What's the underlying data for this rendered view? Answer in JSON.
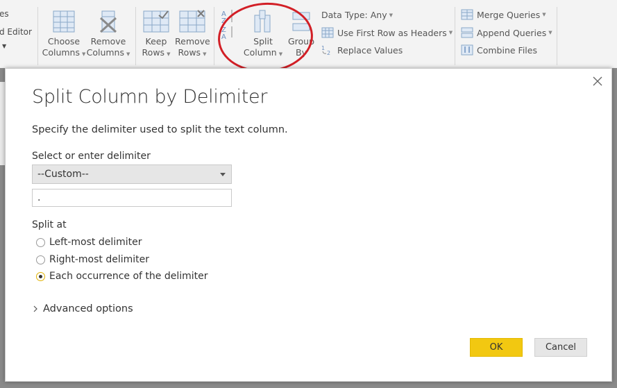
{
  "ribbon": {
    "left_cut_1": "es",
    "left_cut_2": "d Editor",
    "choose_columns": [
      "Choose",
      "Columns"
    ],
    "remove_columns": [
      "Remove",
      "Columns"
    ],
    "keep_rows": [
      "Keep",
      "Rows"
    ],
    "remove_rows": [
      "Remove",
      "Rows"
    ],
    "split_column": [
      "Split",
      "Column"
    ],
    "group_by": [
      "Group",
      "By"
    ],
    "data_type": "Data Type: Any",
    "use_first_row": "Use First Row as Headers",
    "replace_values": "Replace Values",
    "merge_queries": "Merge Queries",
    "append_queries": "Append Queries",
    "combine_files": "Combine Files",
    "highlight_color": "#d21f26"
  },
  "dialog": {
    "title": "Split Column by Delimiter",
    "description": "Specify the delimiter used to split the text column.",
    "select_label": "Select or enter delimiter",
    "select_value": "--Custom--",
    "custom_value": ".",
    "split_at_label": "Split at",
    "options": [
      {
        "label": "Left-most delimiter",
        "checked": false
      },
      {
        "label": "Right-most delimiter",
        "checked": false
      },
      {
        "label": "Each occurrence of the delimiter",
        "checked": true
      }
    ],
    "advanced": "Advanced options",
    "ok": "OK",
    "cancel": "Cancel",
    "accent_color": "#f2c811"
  }
}
